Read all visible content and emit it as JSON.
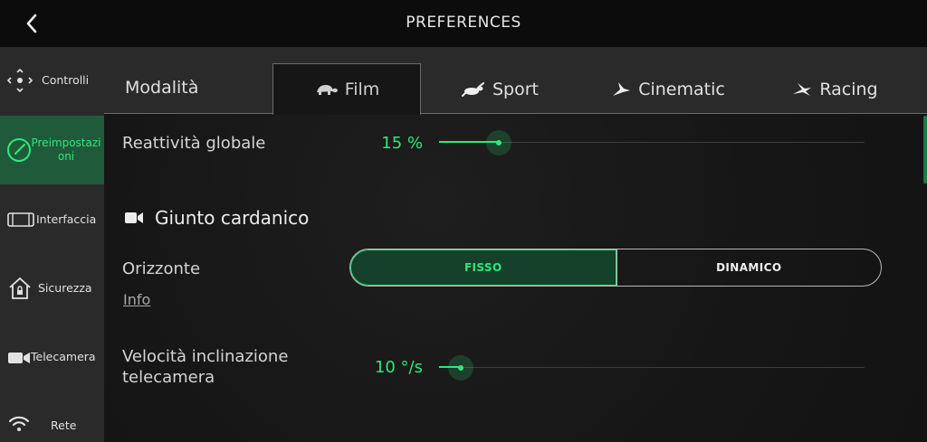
{
  "header": {
    "title": "PREFERENCES",
    "back_icon": "chevron-left-icon"
  },
  "sidebar": {
    "items": [
      {
        "label": "Controlli",
        "icon": "move-arrows-icon",
        "active": false
      },
      {
        "label": "Preimpostazioni",
        "icon": "gauge-icon",
        "active": true
      },
      {
        "label": "Interfaccia",
        "icon": "screen-icon",
        "active": false
      },
      {
        "label": "Sicurezza",
        "icon": "home-lock-icon",
        "active": false
      },
      {
        "label": "Telecamera",
        "icon": "camera-icon",
        "active": false
      },
      {
        "label": "Rete",
        "icon": "wifi-icon",
        "active": false
      }
    ]
  },
  "tabs": {
    "mode_label": "Modalità",
    "items": [
      {
        "label": "Film",
        "icon": "turtle-icon",
        "active": true
      },
      {
        "label": "Sport",
        "icon": "rabbit-icon",
        "active": false
      },
      {
        "label": "Cinematic",
        "icon": "bird-icon",
        "active": false
      },
      {
        "label": "Racing",
        "icon": "swallow-icon",
        "active": false
      }
    ]
  },
  "settings": {
    "global_reactivity": {
      "label": "Reattività globale",
      "value_text": "15 %",
      "level": 0.15
    },
    "gimbal_section": {
      "title": "Giunto cardanico",
      "icon": "video-camera-icon"
    },
    "horizon": {
      "label": "Orizzonte",
      "options": [
        "FISSO",
        "DINAMICO"
      ],
      "selected": "FISSO",
      "info_label": "Info"
    },
    "tilt_speed": {
      "label_line1": "Velocità inclinazione",
      "label_line2": "telecamera",
      "value_text": "10 °/s",
      "level": 0.05
    }
  },
  "colors": {
    "accent": "#2ee87a",
    "active_bg": "#1f5a3a"
  }
}
